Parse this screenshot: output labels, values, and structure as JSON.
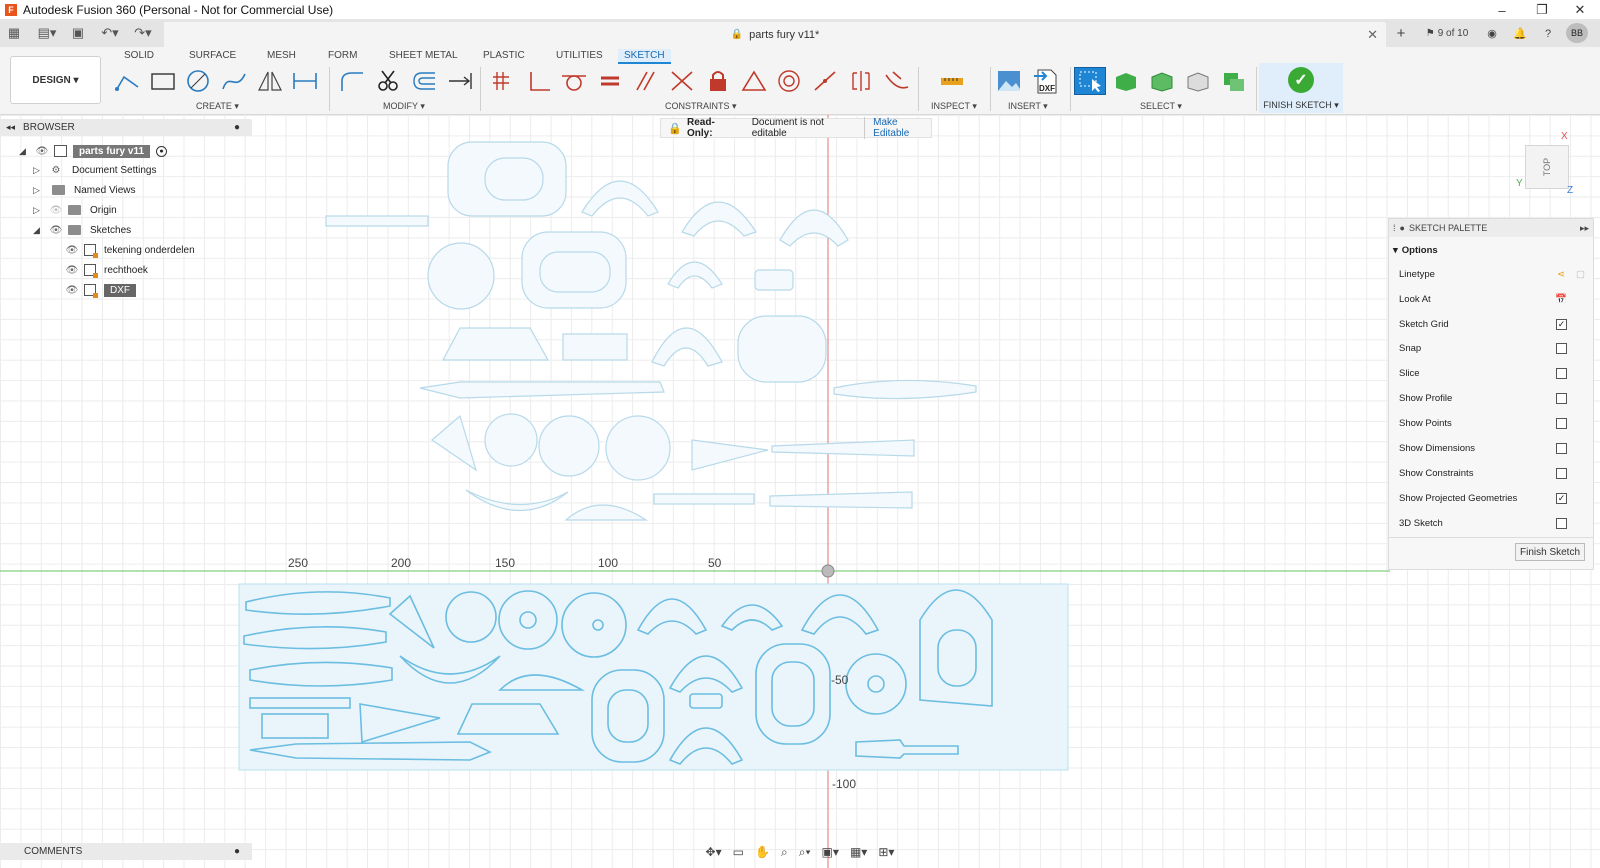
{
  "window": {
    "title": "Autodesk Fusion 360 (Personal - Not for Commercial Use)",
    "app_icon": "F",
    "controls": {
      "minimize": "–",
      "maximize": "❐",
      "close": "✕"
    }
  },
  "tabstrip": {
    "doc_title": "parts fury v11*",
    "version_label": "9 of 10",
    "user_initials": "BB"
  },
  "ribbon": {
    "tabs": [
      "SOLID",
      "SURFACE",
      "MESH",
      "FORM",
      "SHEET METAL",
      "PLASTIC",
      "UTILITIES",
      "SKETCH"
    ],
    "active_tab": "SKETCH",
    "workspace": "DESIGN ▾",
    "groups": {
      "create": "CREATE ▾",
      "modify": "MODIFY ▾",
      "constraints": "CONSTRAINTS ▾",
      "inspect": "INSPECT ▾",
      "insert": "INSERT ▾",
      "select": "SELECT ▾",
      "finish": "FINISH SKETCH ▾"
    },
    "insert_dxf_label": "DXF"
  },
  "browser": {
    "title": "BROWSER",
    "items": [
      {
        "label": "parts fury v11"
      },
      {
        "label": "Document Settings"
      },
      {
        "label": "Named Views"
      },
      {
        "label": "Origin"
      },
      {
        "label": "Sketches"
      },
      {
        "label": "tekening onderdelen"
      },
      {
        "label": "rechthoek"
      },
      {
        "label": "DXF"
      }
    ]
  },
  "readonly": {
    "label": "Read-Only:",
    "message": "Document is not editable",
    "action": "Make Editable"
  },
  "palette": {
    "title": "SKETCH PALETTE",
    "section": "Options",
    "options": [
      {
        "label": "Linetype",
        "checked": null
      },
      {
        "label": "Look At",
        "checked": null
      },
      {
        "label": "Sketch Grid",
        "checked": true
      },
      {
        "label": "Snap",
        "checked": false
      },
      {
        "label": "Slice",
        "checked": false
      },
      {
        "label": "Show Profile",
        "checked": false
      },
      {
        "label": "Show Points",
        "checked": false
      },
      {
        "label": "Show Dimensions",
        "checked": false
      },
      {
        "label": "Show Constraints",
        "checked": false
      },
      {
        "label": "Show Projected Geometries",
        "checked": true
      },
      {
        "label": "3D Sketch",
        "checked": false
      }
    ],
    "finish_button": "Finish Sketch"
  },
  "viewcube": {
    "face": "TOP",
    "x": "X",
    "y": "Y",
    "z": "Z"
  },
  "canvas": {
    "ruler_x": [
      "250",
      "200",
      "150",
      "100",
      "50"
    ],
    "ruler_y": [
      "-50",
      "-100"
    ]
  },
  "comments": {
    "title": "COMMENTS"
  },
  "colors": {
    "sketch_line": "#8ec9e4",
    "sketch_line_dark": "#5fb4da",
    "axis_red": "#e57373",
    "axis_green": "#80d080",
    "accent_blue": "#1f86d6"
  }
}
